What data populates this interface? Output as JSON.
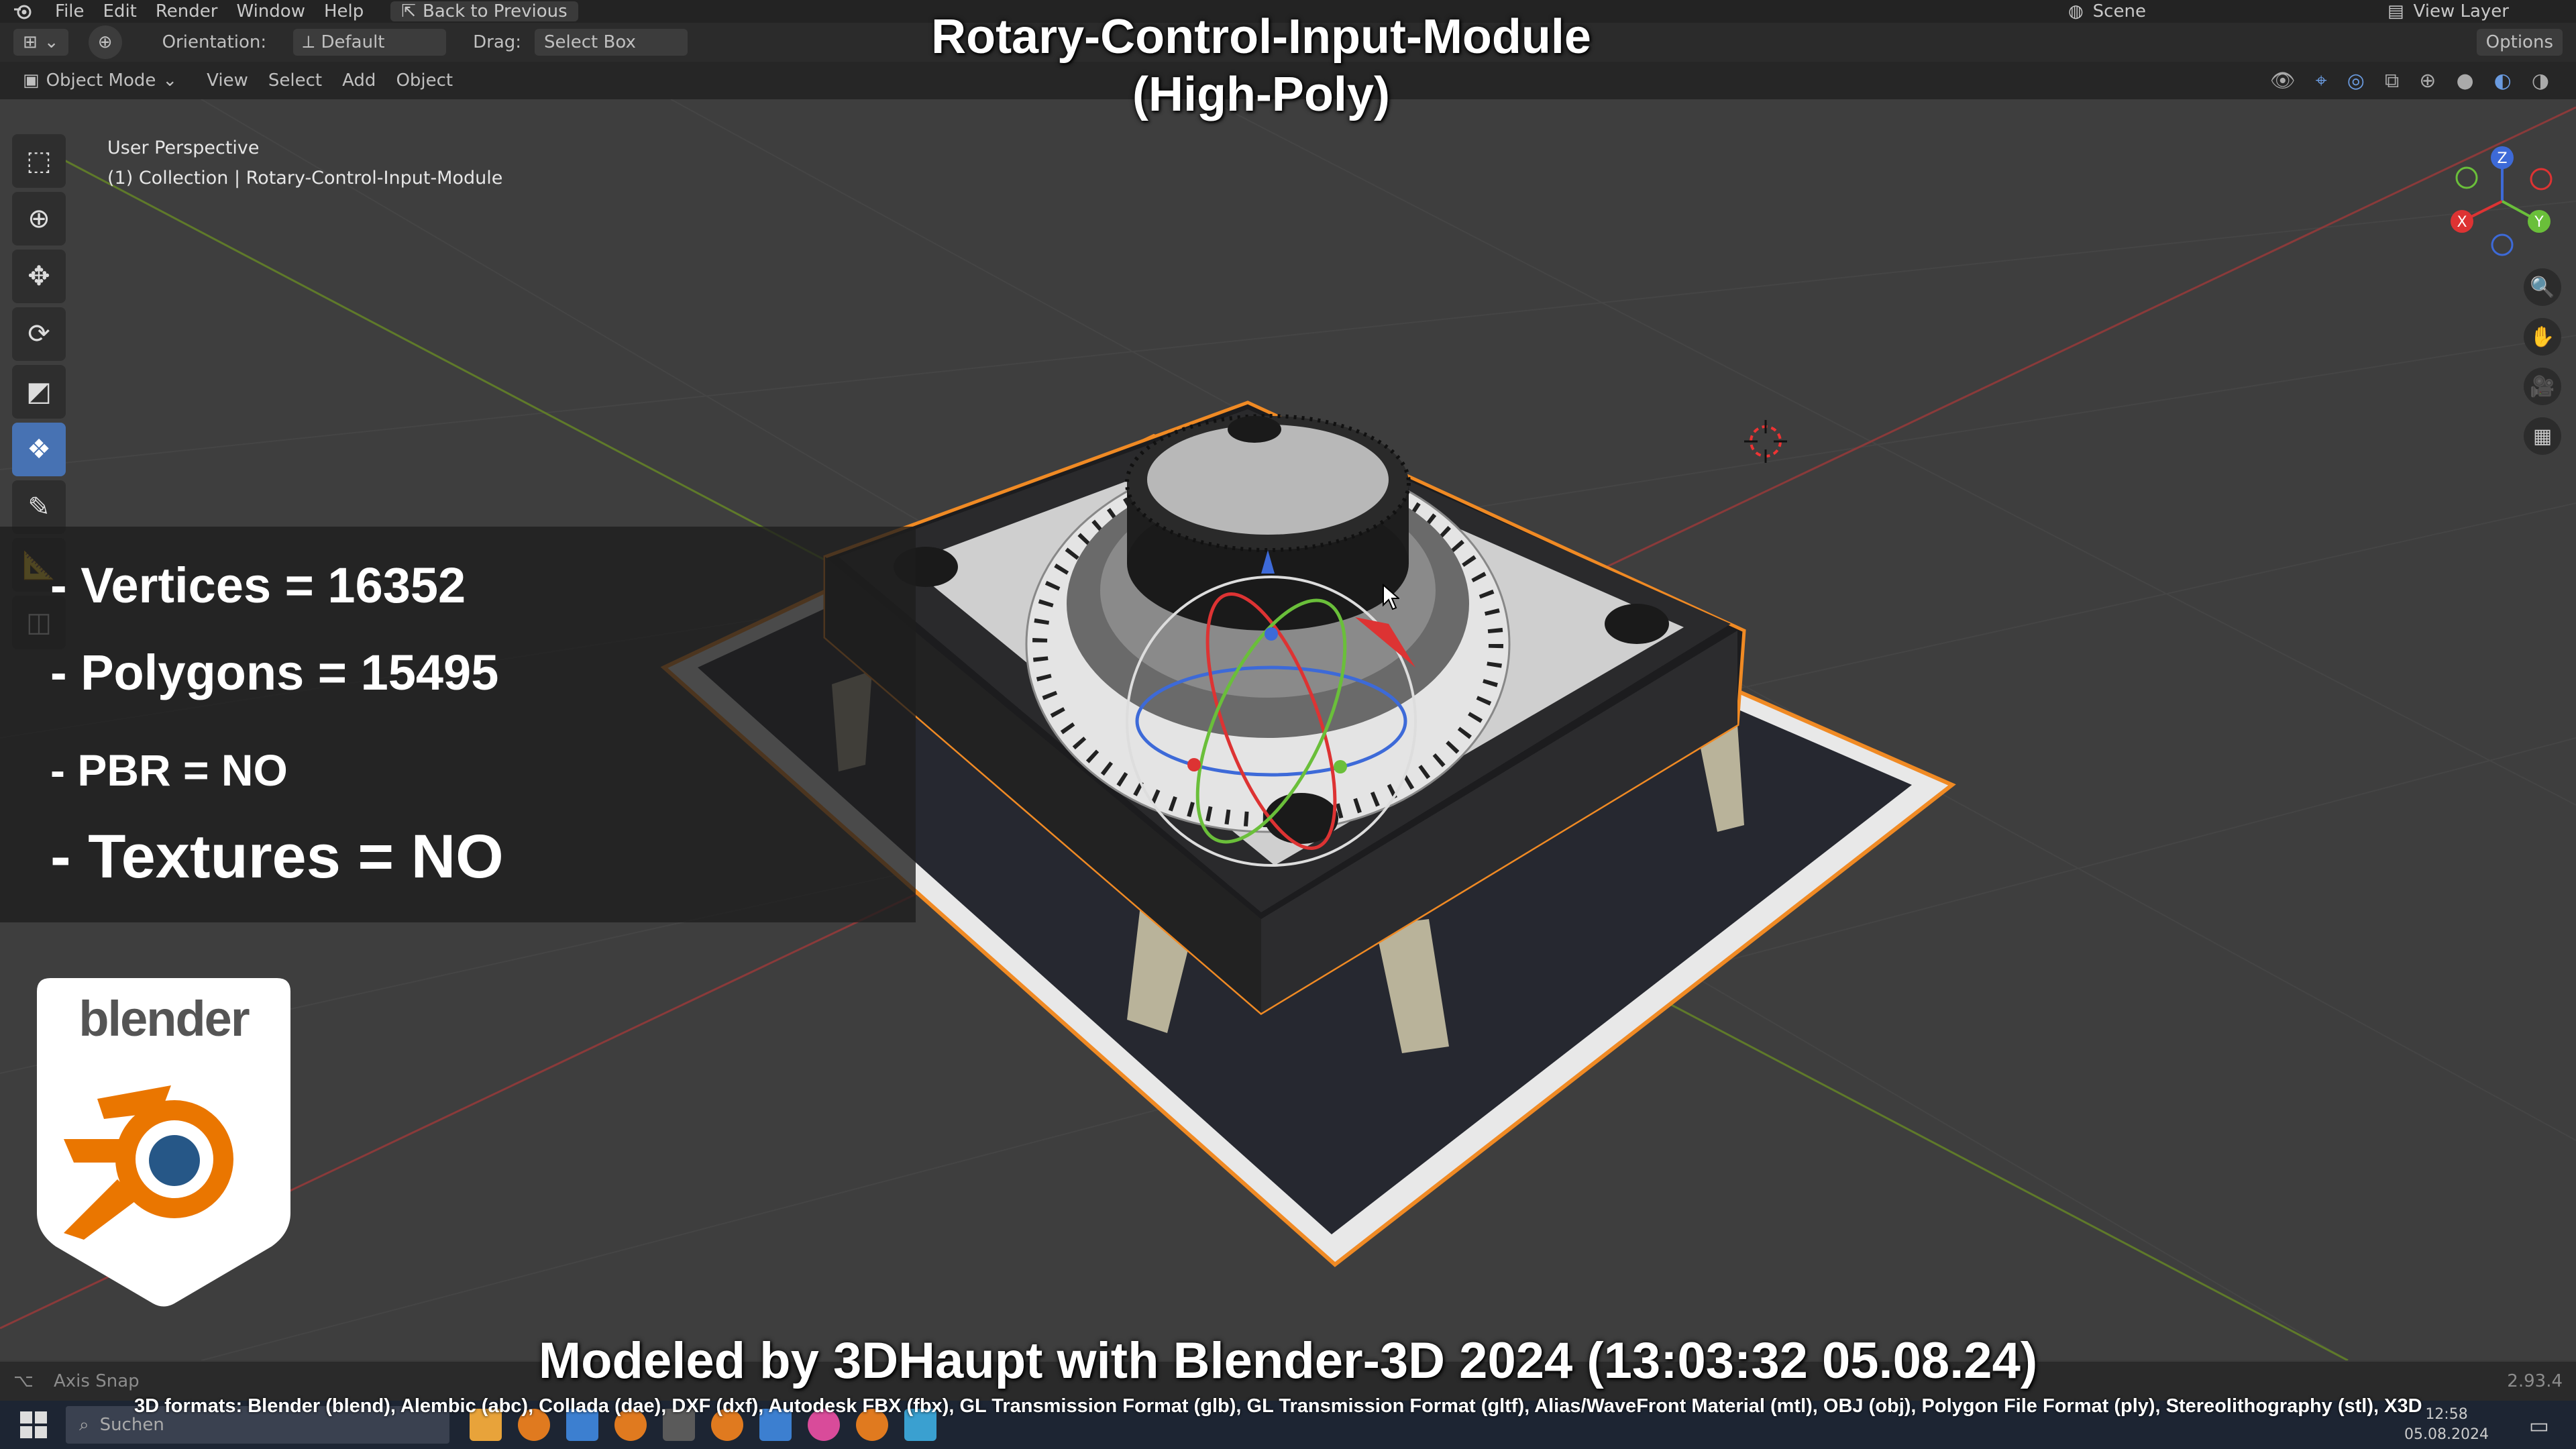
{
  "menu": {
    "items": [
      "File",
      "Edit",
      "Render",
      "Window",
      "Help"
    ],
    "back_button": "Back to Previous",
    "scene": "Scene",
    "view_layer": "View Layer"
  },
  "header": {
    "orientation_label": "Orientation:",
    "orientation_value": "Default",
    "drag_label": "Drag:",
    "drag_value": "Select Box",
    "options": "Options"
  },
  "header2": {
    "mode": "Object Mode",
    "items": [
      "View",
      "Select",
      "Add",
      "Object"
    ]
  },
  "viewport": {
    "perspective": "User Perspective",
    "collection": "(1) Collection | Rotary-Control-Input-Module"
  },
  "overlay": {
    "title_line1": "Rotary-Control-Input-Module",
    "title_line2": "(High-Poly)",
    "vertices": "- Vertices = 16352",
    "polygons": "- Polygons = 15495",
    "pbr": "- PBR =  NO",
    "textures": "- Textures = NO",
    "brand": "blender",
    "credit": "Modeled by 3DHaupt with Blender-3D 2024 (13:03:32  05.08.24)",
    "formats": "3D formats: Blender (blend), Alembic (abc), Collada (dae), DXF (dxf), Autodesk FBX (fbx), GL Transmission Format (glb), GL Transmission Format (gltf), Alias/WaveFront Material (mtl), OBJ (obj), Polygon File Format (ply), Stereolithography (stl), X3D"
  },
  "status": {
    "axis_snap": "Axis Snap",
    "version": "2.93.4"
  },
  "taskbar": {
    "search": "Suchen",
    "time": "12:58",
    "date": "05.08.2024"
  },
  "gizmo": {
    "z": "Z",
    "x": "X",
    "y": "Y"
  },
  "colors": {
    "accent": "#4772b3",
    "selection": "#f08a24",
    "blender_orange": "#ea7600",
    "blender_blue": "#265787"
  }
}
